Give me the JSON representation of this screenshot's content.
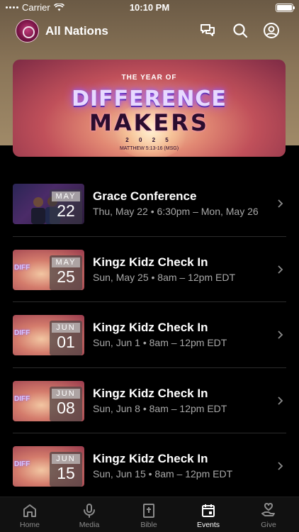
{
  "status_bar": {
    "carrier": "Carrier",
    "time": "10:10 PM"
  },
  "header": {
    "title": "All Nations",
    "icons": [
      "chat-icon",
      "search-icon",
      "profile-icon"
    ]
  },
  "banner": {
    "line1": "THE YEAR OF",
    "line2": "DIFFERENCE",
    "line3": "MAKERS",
    "line4": "2 0 2 5",
    "line5": "MATTHEW 5:13-16 (MSG)"
  },
  "events": [
    {
      "title": "Grace Conference",
      "subtitle": "Thu, May 22 • 6:30pm – Mon, May 26",
      "month": "MAY",
      "day": "22",
      "thumb": "conference"
    },
    {
      "title": "Kingz Kidz Check In",
      "subtitle": "Sun, May 25 • 8am – 12pm EDT",
      "month": "MAY",
      "day": "25",
      "thumb": "difference-makers"
    },
    {
      "title": "Kingz Kidz Check In",
      "subtitle": "Sun, Jun 1 • 8am – 12pm EDT",
      "month": "JUN",
      "day": "01",
      "thumb": "difference-makers"
    },
    {
      "title": "Kingz Kidz Check In",
      "subtitle": "Sun, Jun 8 • 8am – 12pm EDT",
      "month": "JUN",
      "day": "08",
      "thumb": "difference-makers"
    },
    {
      "title": "Kingz Kidz Check In",
      "subtitle": "Sun, Jun 15 • 8am – 12pm EDT",
      "month": "JUN",
      "day": "15",
      "thumb": "difference-makers"
    }
  ],
  "tabbar": {
    "tabs": [
      {
        "label": "Home",
        "icon": "home-icon"
      },
      {
        "label": "Media",
        "icon": "microphone-icon"
      },
      {
        "label": "Bible",
        "icon": "bible-icon"
      },
      {
        "label": "Events",
        "icon": "calendar-icon"
      },
      {
        "label": "Give",
        "icon": "give-icon"
      }
    ],
    "active": "Events"
  },
  "colors": {
    "background": "#000000",
    "header_bg": "#8a7558",
    "muted_text": "#a8a8a8",
    "active_tab": "#ffffff",
    "inactive_tab": "#8c8c8c"
  }
}
